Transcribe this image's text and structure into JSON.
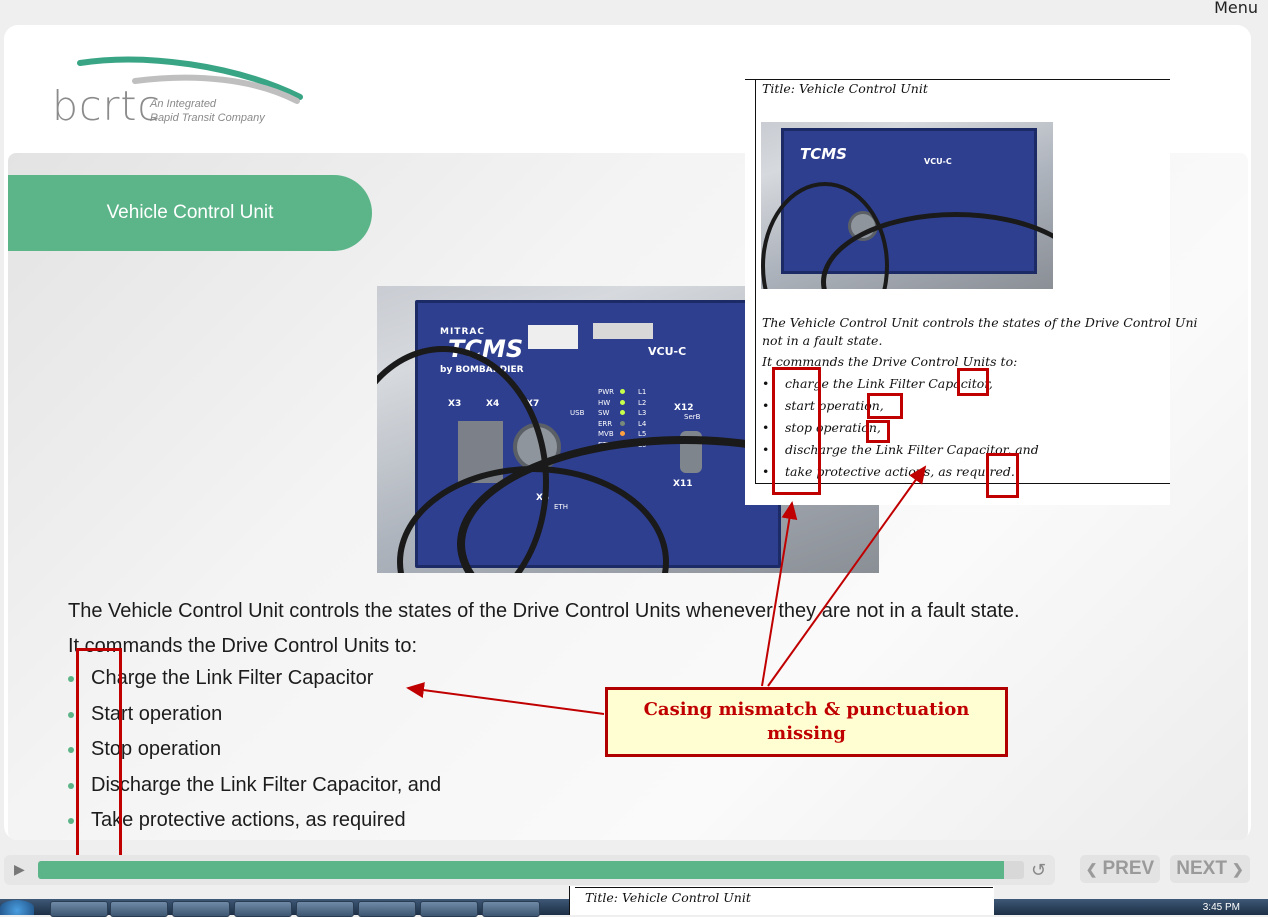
{
  "menu": {
    "label": "Menu"
  },
  "logo": {
    "wordmark": "bcrtc",
    "tagline_1": "An Integrated",
    "tagline_2": "Rapid Transit Company"
  },
  "slide": {
    "title": "Vehicle Control Unit",
    "paragraph_1": "The Vehicle Control Unit controls the states of the Drive Control Units whenever they are not in a fault state.",
    "paragraph_2": "It commands the Drive Control Units to:",
    "bullets": [
      "Charge the Link Filter Capacitor",
      "Start operation",
      "Stop operation",
      "Discharge the Link Filter Capacitor, and",
      "Take protective actions, as required"
    ]
  },
  "photo_labels": {
    "brand": "MITRAC",
    "product": "TCMS",
    "maker": "by BOMBARDIER",
    "model": "VCU-C",
    "leds": [
      "PWR",
      "HW",
      "SW",
      "ERR",
      "MVB",
      "ETH"
    ],
    "led_lanes": [
      "L1",
      "L2",
      "L3",
      "L4",
      "L5",
      "L6"
    ],
    "ports": [
      "X3",
      "X4",
      "X7",
      "X12",
      "X5",
      "X11"
    ],
    "port_sub": {
      "usb": "USB",
      "ser": "SerB",
      "eth": "ETH"
    }
  },
  "reference_doc": {
    "title": "Title: Vehicle Control Unit",
    "para_1a": "The Vehicle Control Unit controls the states of the Drive Control Uni",
    "para_1b": "not in a fault state.",
    "para_2": "It commands the Drive Control Units to:",
    "bullets": [
      "charge the Link Filter Capacitor,",
      "start operation,",
      "stop operation,",
      "discharge the Link Filter Capacitor, and",
      "take protective actions, as required."
    ]
  },
  "callout": {
    "text": "Casing mismatch & punctuation missing"
  },
  "player": {
    "progress": 0.98,
    "prev_label": "PREV",
    "next_label": "NEXT",
    "prev_icon": "chevron-left-icon",
    "next_icon": "chevron-right-icon"
  },
  "taskbar": {
    "clock": "3:45 PM",
    "doc_title": "Title: Vehicle Control Unit"
  },
  "colors": {
    "accent_green": "#5cb589",
    "annotation_red": "#c00000",
    "callout_bg": "#fffed2"
  }
}
